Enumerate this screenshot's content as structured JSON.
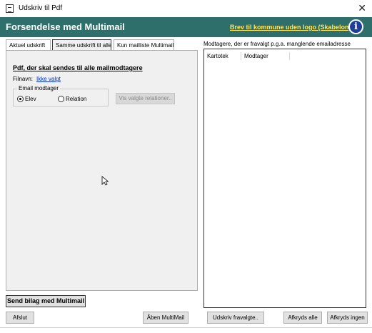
{
  "window": {
    "title": "Udskriv til Pdf",
    "close_glyph": "✕"
  },
  "header": {
    "heading": "Forsendelse med Multimail",
    "link": "Brev til kommune uden logo (Skabelon)",
    "info_glyph": "i"
  },
  "tabs": [
    {
      "label": "Aktuel udskrift",
      "active": false
    },
    {
      "label": "Samme udskrift til alle",
      "active": true
    },
    {
      "label": "Kun mailliste Multimail",
      "active": false
    }
  ],
  "panel": {
    "title": "Pdf, der skal sendes til alle mailmodtagere",
    "filnavn_label": "Filnavn:",
    "filnavn_value": "Ikke valgt",
    "email_group_label": "Email modtager",
    "radios": [
      {
        "label": "Elev",
        "checked": true
      },
      {
        "label": "Relation",
        "checked": false
      }
    ],
    "show_relations_button": "Vis valgte relationer..",
    "send_button": "Send bilag med Multimail"
  },
  "right_panel": {
    "label": "Modtagere, der er fravalgt p.g.a. manglende emailadresse",
    "columns": [
      "Kartotek",
      "Modtager"
    ]
  },
  "footer": {
    "afslut": "Afslut",
    "aaben": "Åben MultiMail",
    "udskriv": "Udskriv fravalgte..",
    "afkryds_alle": "Afkryds alle",
    "afkryds_ingen": "Afkryds ingen"
  },
  "colors": {
    "header_bg": "#2f6f6b",
    "header_link": "#ffe65a",
    "info_icon": "#1f3e9a"
  }
}
